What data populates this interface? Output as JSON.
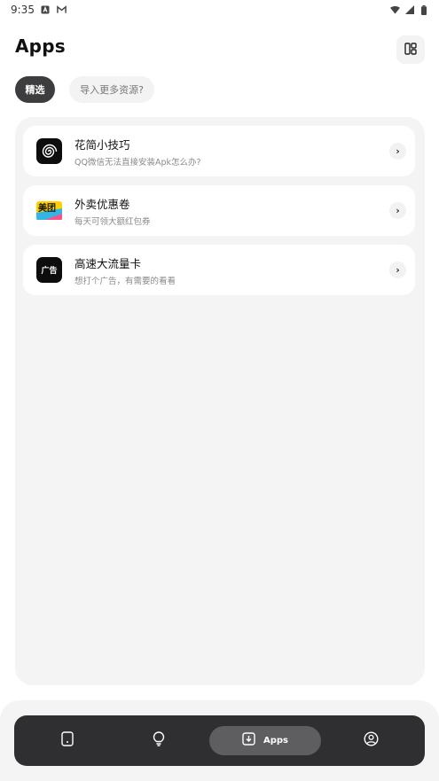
{
  "status_bar": {
    "time": "9:35"
  },
  "header": {
    "title": "Apps"
  },
  "filters": [
    {
      "label": "精选"
    },
    {
      "label": "导入更多资源?"
    }
  ],
  "apps": [
    {
      "title": "花简小技巧",
      "subtitle": "QQ微信无法直接安装Apk怎么办?",
      "icon": "spiral-icon"
    },
    {
      "title": "外卖优惠卷",
      "subtitle": "每天可领大额红包券",
      "icon": "meituan-icon",
      "icon_text": "美团"
    },
    {
      "title": "高速大流量卡",
      "subtitle": "想打个广告，有需要的看看",
      "icon": "ad-icon",
      "icon_text": "广告"
    }
  ],
  "bottom_nav": {
    "items": [
      {
        "icon": "phone-icon"
      },
      {
        "icon": "lightbulb-icon"
      },
      {
        "icon": "download-icon",
        "label": "Apps",
        "active": true
      },
      {
        "icon": "user-icon"
      }
    ]
  },
  "colors": {
    "nav_bg": "#2f2f31",
    "chip_selected": "#3d3d3f",
    "panel_bg": "#f4f4f4"
  }
}
